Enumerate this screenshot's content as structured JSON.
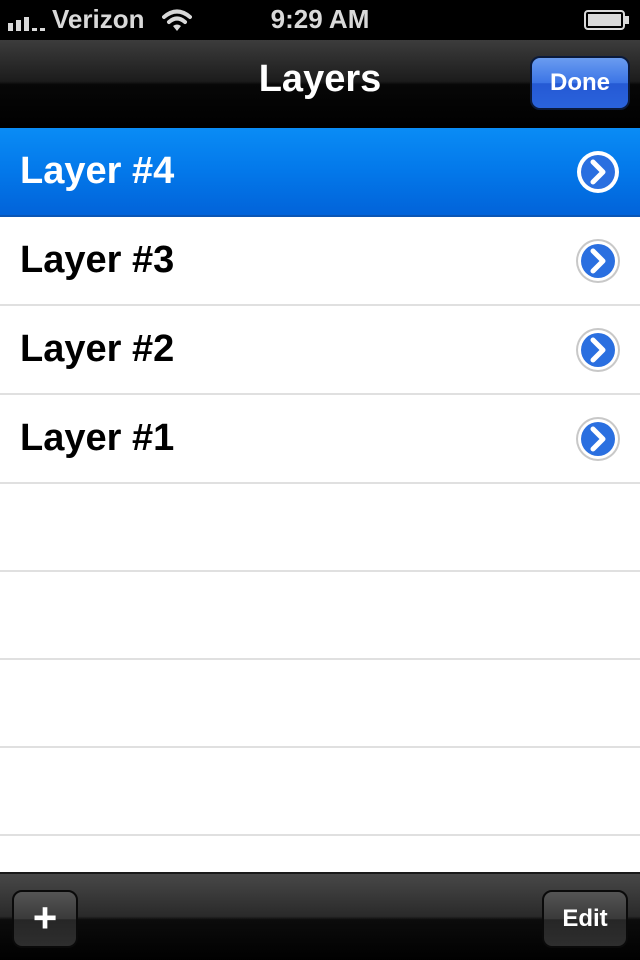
{
  "status_bar": {
    "carrier": "Verizon",
    "time": "9:29 AM",
    "signal_icon": "signal-bars-icon",
    "wifi_icon": "wifi-icon",
    "battery_icon": "battery-icon"
  },
  "nav_bar": {
    "title": "Layers",
    "done_label": "Done"
  },
  "layers": {
    "items": [
      {
        "label": "Layer #4",
        "selected": true
      },
      {
        "label": "Layer #3",
        "selected": false
      },
      {
        "label": "Layer #2",
        "selected": false
      },
      {
        "label": "Layer #1",
        "selected": false
      }
    ],
    "disclosure_icon": "chevron-right-circle-icon"
  },
  "toolbar": {
    "add_label": "+",
    "edit_label": "Edit"
  },
  "colors": {
    "selection_blue": "#0378ea",
    "done_blue": "#3b74e6"
  }
}
